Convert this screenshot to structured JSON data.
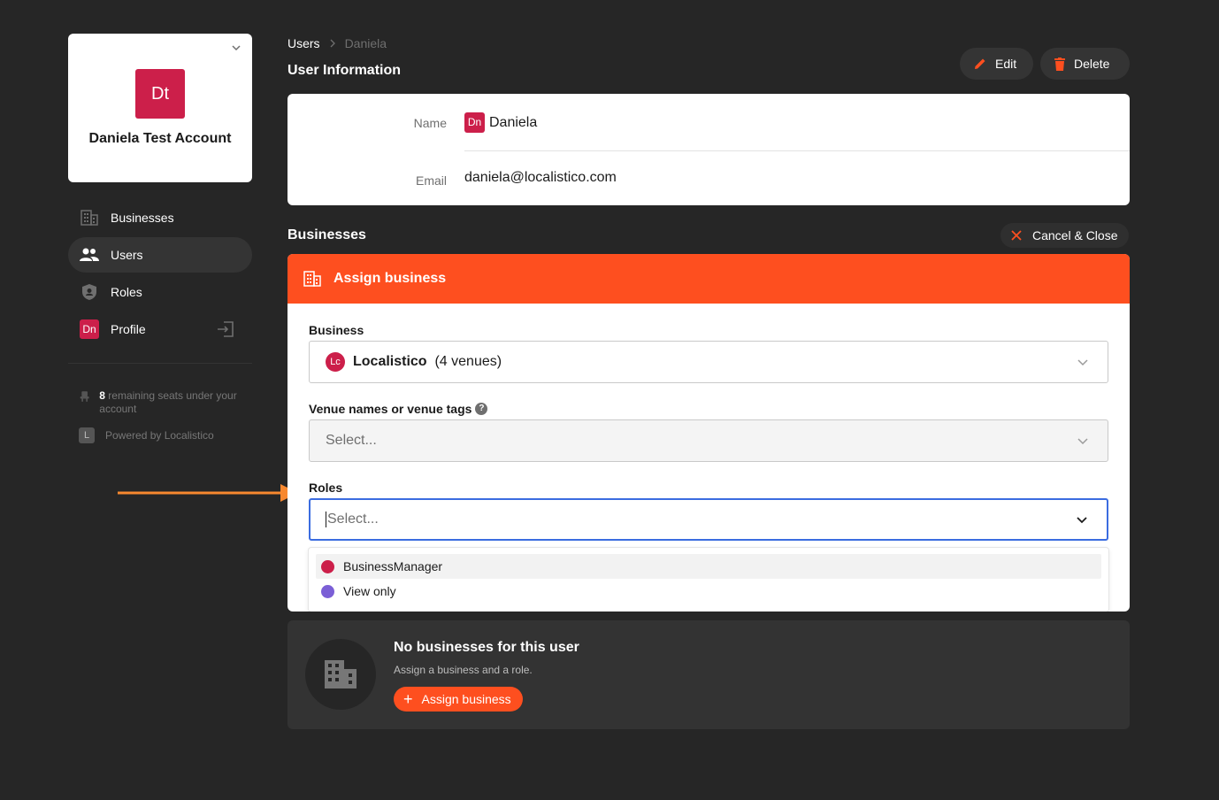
{
  "account": {
    "initials": "Dt",
    "name": "Daniela Test Account",
    "logo_color": "#cc1f4a"
  },
  "nav": {
    "items": [
      {
        "label": "Businesses",
        "icon": "building-icon"
      },
      {
        "label": "Users",
        "icon": "users-icon",
        "active": true
      },
      {
        "label": "Roles",
        "icon": "shield-icon"
      },
      {
        "label": "Profile",
        "icon": "profile-avatar",
        "avatar": "Dn"
      }
    ]
  },
  "seats": {
    "count": "8",
    "text": " remaining seats under your account"
  },
  "powered": {
    "logo": "L",
    "text": "Powered by Localistico"
  },
  "breadcrumb": {
    "parent": "Users",
    "current": "Daniela"
  },
  "user_info": {
    "title": "User Information",
    "edit_label": "Edit",
    "delete_label": "Delete",
    "name_label": "Name",
    "name_avatar": "Dn",
    "name_value": "Daniela",
    "email_label": "Email",
    "email_value": "daniela@localistico.com"
  },
  "businesses": {
    "title": "Businesses",
    "cancel_label": "Cancel & Close"
  },
  "assign_form": {
    "header": "Assign business",
    "business_label": "Business",
    "business_avatar": "Lc",
    "business_name": "Localistico",
    "business_venues": "(4 venues)",
    "venues_label": "Venue names or venue tags",
    "help_glyph": "?",
    "venues_placeholder": "Select...",
    "roles_label": "Roles",
    "roles_placeholder": "Select...",
    "role_options": [
      {
        "label": "BusinessManager",
        "color": "#cc1f4a"
      },
      {
        "label": "View only",
        "color": "#7b5fd6"
      }
    ]
  },
  "empty_state": {
    "title": "No businesses for this user",
    "subtitle": "Assign a business and a role.",
    "button_label": "Assign business"
  },
  "colors": {
    "accent": "#fe4f1f",
    "background": "#262626",
    "brand_red": "#cc1f4a",
    "annotation_arrow": "#f7882f",
    "focus_border": "#3b6ce0"
  }
}
